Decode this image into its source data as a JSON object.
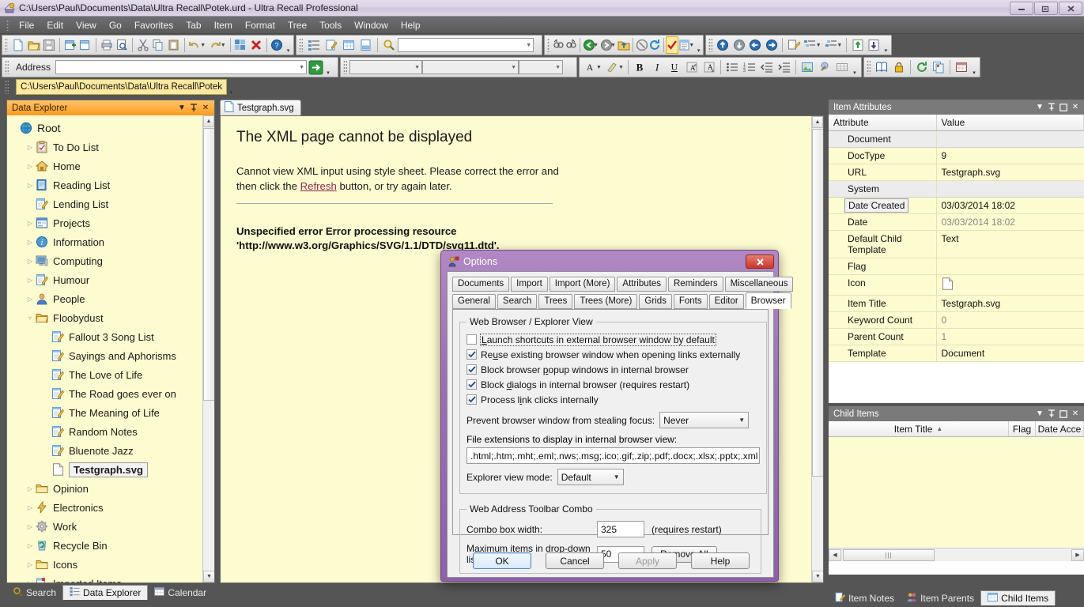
{
  "window": {
    "title": "C:\\Users\\Paul\\Documents\\Data\\Ultra Recall\\Potek.urd - Ultra Recall Professional",
    "minimize": "–",
    "restore": "❐",
    "close": "✕"
  },
  "menu": {
    "items": [
      "File",
      "Edit",
      "View",
      "Go",
      "Favorites",
      "Tab",
      "Item",
      "Format",
      "Tree",
      "Tools",
      "Window",
      "Help"
    ]
  },
  "toolbar": {
    "address_label": "Address",
    "address_value": "",
    "history_value": "C:\\Users\\Paul\\Documents\\Data\\Ultra Recall\\Potek",
    "font_name_value": "",
    "font_size_value": "",
    "style_value": ""
  },
  "explorer": {
    "title": "Data Explorer",
    "dropdown": "▼",
    "pin": "☷",
    "close": "✕",
    "nodes": [
      {
        "label": "Root",
        "icon": "globe-icon",
        "depth": 0,
        "expander": "",
        "selected": false
      },
      {
        "label": "To Do List",
        "icon": "checklist-icon",
        "depth": 1,
        "expander": "▷",
        "selected": false
      },
      {
        "label": "Home",
        "icon": "house-icon",
        "depth": 1,
        "expander": "▷",
        "selected": false
      },
      {
        "label": "Reading List",
        "icon": "book-icon",
        "depth": 1,
        "expander": "▷",
        "selected": false
      },
      {
        "label": "Lending List",
        "icon": "note-icon",
        "depth": 1,
        "expander": "",
        "selected": false
      },
      {
        "label": "Projects",
        "icon": "project-icon",
        "depth": 1,
        "expander": "▷",
        "selected": false
      },
      {
        "label": "Information",
        "icon": "info-icon",
        "depth": 1,
        "expander": "▷",
        "selected": false
      },
      {
        "label": "Computing",
        "icon": "monitor-icon",
        "depth": 1,
        "expander": "▷",
        "selected": false
      },
      {
        "label": "Humour",
        "icon": "note-icon",
        "depth": 1,
        "expander": "▷",
        "selected": false
      },
      {
        "label": "People",
        "icon": "person-icon",
        "depth": 1,
        "expander": "▷",
        "selected": false
      },
      {
        "label": "Floobydust",
        "icon": "folder-open-icon",
        "depth": 1,
        "expander": "▿",
        "selected": false
      },
      {
        "label": "Fallout 3 Song List",
        "icon": "note-icon",
        "depth": 2,
        "expander": "",
        "selected": false
      },
      {
        "label": "Sayings and Aphorisms",
        "icon": "note-icon",
        "depth": 2,
        "expander": "",
        "selected": false
      },
      {
        "label": "The Love of Life",
        "icon": "note-icon",
        "depth": 2,
        "expander": "",
        "selected": false
      },
      {
        "label": "The Road goes ever on",
        "icon": "note-icon",
        "depth": 2,
        "expander": "",
        "selected": false
      },
      {
        "label": "The Meaning of Life",
        "icon": "note-icon",
        "depth": 2,
        "expander": "",
        "selected": false
      },
      {
        "label": "Random Notes",
        "icon": "note-icon",
        "depth": 2,
        "expander": "",
        "selected": false
      },
      {
        "label": "Bluenote Jazz",
        "icon": "note-icon",
        "depth": 2,
        "expander": "",
        "selected": false
      },
      {
        "label": "Testgraph.svg",
        "icon": "document-icon",
        "depth": 2,
        "expander": "",
        "selected": true
      },
      {
        "label": "Opinion",
        "icon": "folder-icon",
        "depth": 1,
        "expander": "▷",
        "selected": false
      },
      {
        "label": "Electronics",
        "icon": "lightning-icon",
        "depth": 1,
        "expander": "▷",
        "selected": false
      },
      {
        "label": "Work",
        "icon": "gear-icon",
        "depth": 1,
        "expander": "▷",
        "selected": false
      },
      {
        "label": "Recycle Bin",
        "icon": "recycle-icon",
        "depth": 1,
        "expander": "▷",
        "selected": false
      },
      {
        "label": "Icons",
        "icon": "folder-icon",
        "depth": 1,
        "expander": "▷",
        "selected": false
      },
      {
        "label": "Imported Items",
        "icon": "imported-icon",
        "depth": 1,
        "expander": "▷",
        "selected": false
      }
    ],
    "bottom_tabs": [
      {
        "label": "Search",
        "icon": "magnifier-icon",
        "active": false
      },
      {
        "label": "Data Explorer",
        "icon": "tree-icon",
        "active": true
      },
      {
        "label": "Calendar",
        "icon": "calendar-icon",
        "active": false
      }
    ]
  },
  "document": {
    "tab_label": "Testgraph.svg",
    "heading": "The XML page cannot be displayed",
    "body_before_link": "Cannot view XML input using style sheet. Please correct the error and then click the ",
    "link": "Refresh",
    "body_after_link": " button, or try again later.",
    "error_line1": "Unspecified error Error processing resource",
    "error_line2": "'http://www.w3.org/Graphics/SVG/1.1/DTD/svg11.dtd'."
  },
  "attributes_panel": {
    "title": "Item Attributes",
    "columns": [
      "Attribute",
      "Value"
    ],
    "rows": [
      {
        "key": "Document",
        "value": "",
        "group": true
      },
      {
        "key": "DocType",
        "value": "9",
        "group": false
      },
      {
        "key": "URL",
        "value": "Testgraph.svg",
        "group": false
      },
      {
        "key": "System",
        "value": "",
        "group": true
      },
      {
        "key": "Date Created",
        "value": "03/03/2014 18:02",
        "group": false,
        "focused": true
      },
      {
        "key": "Date",
        "value": "03/03/2014 18:02",
        "group": false,
        "dim": true
      },
      {
        "key": "Default Child Template",
        "value": "Text",
        "group": false
      },
      {
        "key": "Flag",
        "value": "",
        "group": false
      },
      {
        "key": "Icon",
        "value": "",
        "group": false,
        "icon": "document-icon"
      },
      {
        "key": "Item Title",
        "value": "Testgraph.svg",
        "group": false
      },
      {
        "key": "Keyword Count",
        "value": "0",
        "group": false,
        "dim": true
      },
      {
        "key": "Parent Count",
        "value": "1",
        "group": false,
        "dim": true
      },
      {
        "key": "Template",
        "value": "Document",
        "group": false
      }
    ]
  },
  "child_items_panel": {
    "title": "Child Items",
    "columns": [
      "Item Title",
      "Flag",
      "Date Acce"
    ],
    "sort_indicator": "▲",
    "rows": [],
    "bottom_tabs": [
      {
        "label": "Item Notes",
        "icon": "notes-icon",
        "active": false
      },
      {
        "label": "Item Parents",
        "icon": "parents-icon",
        "active": false
      },
      {
        "label": "Child Items",
        "icon": "grid-icon",
        "active": true
      }
    ]
  },
  "options_dialog": {
    "title": "Options",
    "close_label": "✕",
    "tabs_row1": [
      "Documents",
      "Import",
      "Import (More)",
      "Attributes",
      "Reminders",
      "Miscellaneous"
    ],
    "tabs_row2": [
      "General",
      "Search",
      "Trees",
      "Trees (More)",
      "Grids",
      "Fonts",
      "Editor",
      "Browser"
    ],
    "active_tab": "Browser",
    "group_browser": {
      "legend": "Web Browser / Explorer View",
      "checkboxes": [
        {
          "label": "Launch shortcuts in external browser window by default",
          "checked": false,
          "focused": true,
          "accel": "L"
        },
        {
          "label": "Reuse existing browser window when opening links externally",
          "checked": true,
          "focused": false,
          "accel": "u"
        },
        {
          "label": "Block browser popup windows in internal browser",
          "checked": true,
          "focused": false,
          "accel": "p"
        },
        {
          "label": "Block dialogs in internal browser (requires restart)",
          "checked": true,
          "focused": false,
          "accel": "d"
        },
        {
          "label": "Process link clicks internally",
          "checked": true,
          "focused": false,
          "accel": "i"
        }
      ],
      "focus_label": "Prevent browser window from stealing focus:",
      "focus_value": "Never",
      "extensions_label": "File extensions to display in internal browser view:",
      "extensions_value": ".html;.htm;.mht;.eml;.nws;.msg;.ico;.gif;.zip;.pdf;.docx;.xlsx;.pptx;.xml",
      "view_mode_label": "Explorer view mode:",
      "view_mode_value": "Default"
    },
    "group_combo": {
      "legend": "Web Address Toolbar Combo",
      "width_label": "Combo box width:",
      "width_value": "325",
      "width_note": "(requires restart)",
      "max_items_label": "Maximum items in drop-down list:",
      "max_items_value": "50",
      "remove_all_label": "Remove All"
    },
    "buttons": [
      {
        "label": "OK",
        "style": "primary"
      },
      {
        "label": "Cancel",
        "style": "normal"
      },
      {
        "label": "Apply",
        "style": "disabled"
      },
      {
        "label": "Help",
        "style": "normal"
      }
    ]
  },
  "colors": {
    "accent_orange": "#ff9b20",
    "panel_yellow": "#fdfbd0",
    "dialog_purple": "#9c6fb3",
    "link": "#8a2b4a",
    "close_red": "#c63a2c"
  }
}
